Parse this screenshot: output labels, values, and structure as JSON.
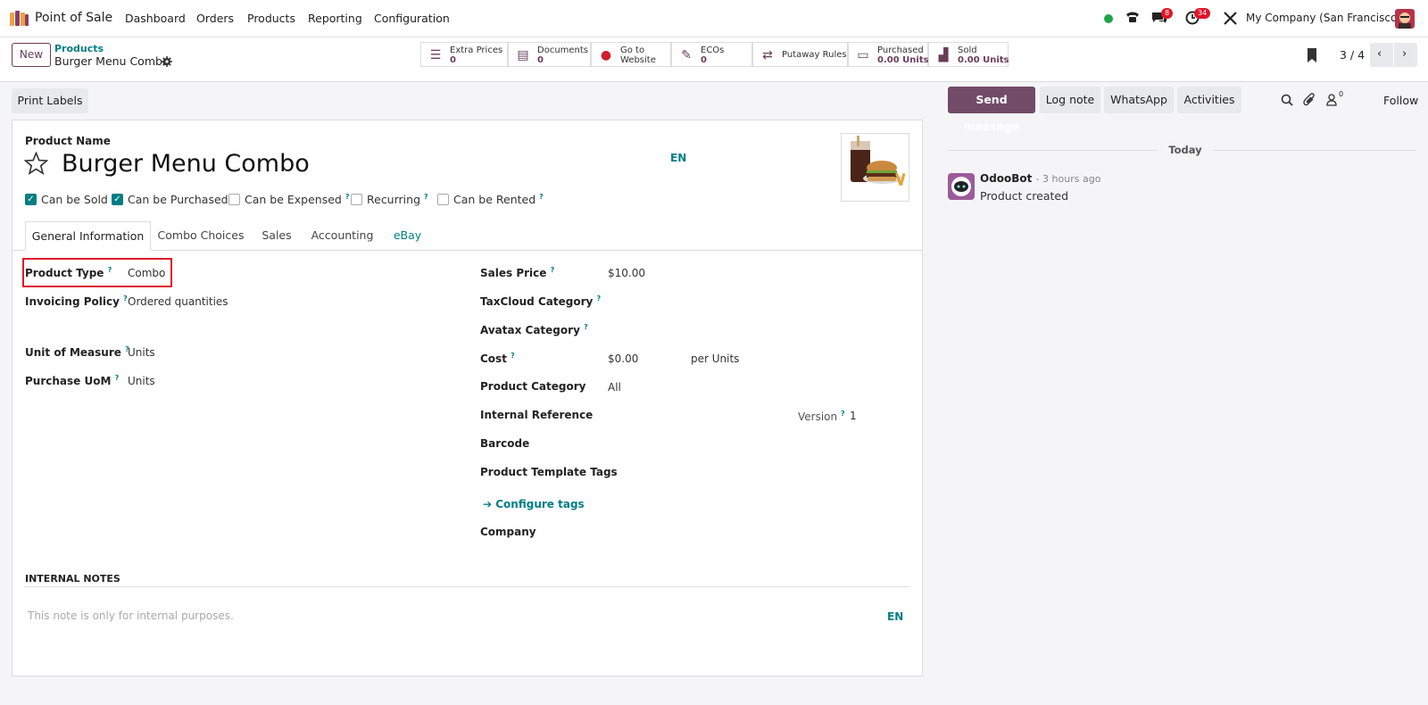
{
  "navbar": {
    "app_name": "Point of Sale",
    "menu": [
      "Dashboard",
      "Orders",
      "Products",
      "Reporting",
      "Configuration"
    ],
    "messages_badge": "8",
    "activities_badge": "34",
    "company": "My Company (San Francisco)"
  },
  "control_panel": {
    "new_label": "New",
    "breadcrumb_parent": "Products",
    "record_name": "Burger Menu Combo",
    "pager": "3 / 4",
    "smart_buttons": [
      {
        "line1": "Extra Prices",
        "line2": "0",
        "icon": "list-icon"
      },
      {
        "line1": "Documents",
        "line2": "0",
        "icon": "document-icon"
      },
      {
        "line1": "Go to",
        "line2": "Website",
        "icon": "globe-icon"
      },
      {
        "line1": "ECOs",
        "line2": "0",
        "icon": "wrench-icon"
      },
      {
        "line1": "Putaway Rules",
        "line2": "",
        "icon": "shuffle-icon"
      },
      {
        "line1": "Purchased",
        "line2": "0.00 Units",
        "icon": "credit-card-icon"
      },
      {
        "line1": "Sold",
        "line2": "0.00 Units",
        "icon": "signal-icon"
      }
    ]
  },
  "actions": {
    "print_labels": "Print Labels"
  },
  "form": {
    "product_name_label": "Product Name",
    "product_name": "Burger Menu Combo",
    "lang": "EN",
    "checkboxes": [
      {
        "label": "Can be Sold",
        "checked": true,
        "help": ""
      },
      {
        "label": "Can be Purchased",
        "checked": true,
        "help": ""
      },
      {
        "label": "Can be Expensed",
        "checked": false,
        "help": "?"
      },
      {
        "label": "Recurring",
        "checked": false,
        "help": "?"
      },
      {
        "label": "Can be Rented",
        "checked": false,
        "help": "?"
      }
    ],
    "tabs": [
      "General Information",
      "Combo Choices",
      "Sales",
      "Accounting",
      "eBay"
    ],
    "left_fields": {
      "product_type_label": "Product Type",
      "product_type": "Combo",
      "invoicing_policy_label": "Invoicing Policy",
      "invoicing_policy": "Ordered quantities",
      "uom_label": "Unit of Measure",
      "uom": "Units",
      "purchase_uom_label": "Purchase UoM",
      "purchase_uom": "Units"
    },
    "right_fields": {
      "sales_price_label": "Sales Price",
      "sales_price": "$10.00",
      "taxcloud_label": "TaxCloud Category",
      "avatax_label": "Avatax Category",
      "cost_label": "Cost",
      "cost": "$0.00",
      "cost_unit": "per Units",
      "category_label": "Product Category",
      "category": "All",
      "internal_ref_label": "Internal Reference",
      "version_label": "Version",
      "version": "1",
      "barcode_label": "Barcode",
      "tags_label": "Product Template Tags",
      "configure_tags": "Configure tags",
      "company_label": "Company"
    },
    "internal_notes_title": "INTERNAL NOTES",
    "internal_notes_placeholder": "This note is only for internal purposes.",
    "notes_lang": "EN"
  },
  "chatter": {
    "send_message": "Send message",
    "log_note": "Log note",
    "whatsapp": "WhatsApp",
    "activities": "Activities",
    "followers_count": "0",
    "follow": "Follow",
    "date_separator": "Today",
    "author": "OdooBot",
    "time": "- 3 hours ago",
    "message": "Product created"
  },
  "colors": {
    "primary": "#714B67",
    "teal": "#017e84",
    "badge_red": "#e0162b"
  }
}
